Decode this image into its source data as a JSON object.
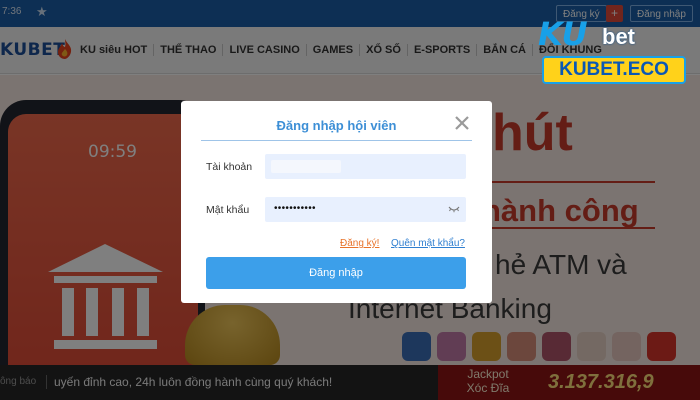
{
  "topbar": {
    "time": "7:36",
    "register_label": "Đăng ký",
    "plus_symbol": "+",
    "login_label": "Đăng nhập"
  },
  "navbar": {
    "logo_text": "KUBET",
    "items": [
      "KU siêu HOT",
      "THỂ THAO",
      "LIVE CASINO",
      "GAMES",
      "XỔ SỐ",
      "E-SPORTS",
      "BẮN CÁ",
      "ĐỔI KHUNG"
    ]
  },
  "hero": {
    "phone_clock": "09:59",
    "heading_1": "hút",
    "heading_2": "hành công",
    "line_1": "hẻ ATM và",
    "line_2": "Internet Banking"
  },
  "ticker": {
    "label": "ông báo",
    "text": "uyến đỉnh cao, 24h luôn đồng hành cùng quý khách!"
  },
  "jackpot": {
    "title_1": "Jackpot",
    "title_2": "Xóc Đĩa",
    "value": "3.137.316,9"
  },
  "watermark": {
    "brand_ku": "KU",
    "brand_bet": "bet",
    "domain": "KUBET.ECO"
  },
  "modal": {
    "title": "Đăng nhập hội viên",
    "username_label": "Tài khoản",
    "username_value": "",
    "password_label": "Mật khẩu",
    "password_mask": "•••••••••••",
    "register_link": "Đăng ký!",
    "forgot_link": "Quên mật khẩu?",
    "submit_label": "Đăng nhập"
  },
  "colors": {
    "accent_blue": "#3c9fea",
    "title_blue": "#3d8fd6",
    "link_orange": "#e8732a",
    "jackpot_gold": "#ffe07a"
  },
  "icons": [
    "star-icon",
    "fire-icon",
    "bank-icon",
    "close-icon",
    "eye-icon"
  ]
}
